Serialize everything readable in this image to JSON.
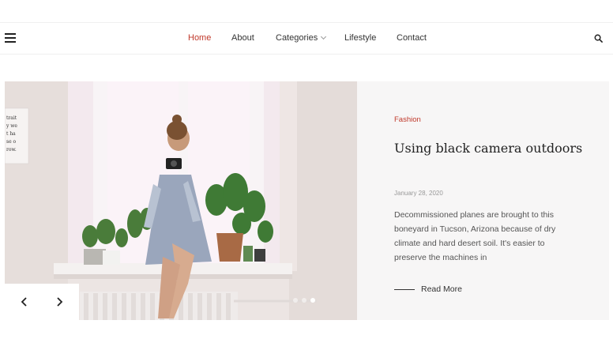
{
  "nav": {
    "items": [
      {
        "label": "Home",
        "active": true
      },
      {
        "label": "About"
      },
      {
        "label": "Categories",
        "has_dropdown": true
      },
      {
        "label": "Lifestyle"
      },
      {
        "label": "Contact"
      }
    ]
  },
  "icons": {
    "menu": "hamburger-icon",
    "search": "search-icon",
    "prev": "chevron-left-icon",
    "next": "chevron-right-icon",
    "dropdown": "chevron-down-icon"
  },
  "colors": {
    "accent": "#c0392b",
    "slide_background": "#f7f6f6",
    "text": "#222222"
  },
  "slide": {
    "category": "Fashion",
    "title": "Using black camera outdoors",
    "date": "January 28, 2020",
    "excerpt": "Decommissioned planes are brought to this boneyard in Tucson, Arizona because of dry climate and hard desert soil. It's easier to preserve the machines in",
    "read_more": "Read More",
    "poster_text": "...",
    "dots_count": 3,
    "active_dot": 3
  }
}
